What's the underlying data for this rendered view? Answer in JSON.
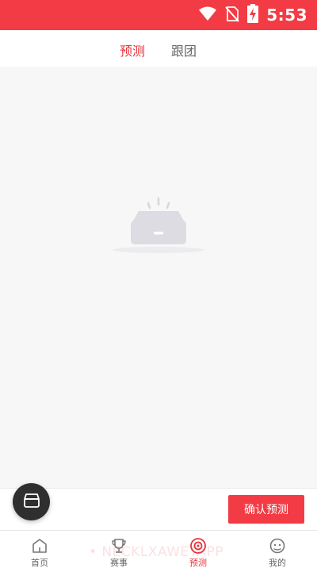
{
  "status_bar": {
    "time": "5:53",
    "icons": [
      "wifi-icon",
      "no-sim-icon",
      "battery-charging-icon"
    ]
  },
  "tabs": [
    {
      "label": "预测",
      "active": true
    },
    {
      "label": "跟团",
      "active": false
    }
  ],
  "empty_state": {
    "icon": "empty-inbox-icon"
  },
  "action_bar": {
    "confirm_label": "确认预测"
  },
  "floating_button": {
    "icon": "box-icon"
  },
  "bottom_nav": [
    {
      "label": "首页",
      "icon": "home-icon",
      "active": false
    },
    {
      "label": "赛事",
      "icon": "trophy-icon",
      "active": false
    },
    {
      "label": "预测",
      "icon": "target-icon",
      "active": true
    },
    {
      "label": "我的",
      "icon": "face-icon",
      "active": false
    }
  ],
  "watermark": "• NECKLXAWETAPP",
  "colors": {
    "accent": "#f23b44",
    "active_text": "#e8323c",
    "background": "#f7f7f8"
  }
}
